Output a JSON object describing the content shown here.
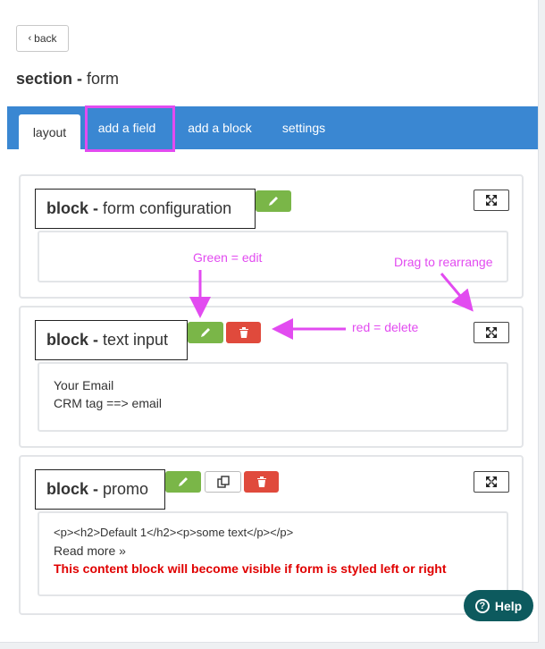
{
  "header": {
    "back_label": "back",
    "title_bold": "section -",
    "title_rest": "form"
  },
  "tabs": [
    {
      "label": "layout",
      "active": true
    },
    {
      "label": "add a field",
      "active": false
    },
    {
      "label": "add a block",
      "active": false
    },
    {
      "label": "settings",
      "active": false
    }
  ],
  "blocks": [
    {
      "kind_label": "block -",
      "name": "form configuration",
      "lines": []
    },
    {
      "kind_label": "block -",
      "name": "text input",
      "lines": [
        "Your Email",
        "CRM tag ==> email"
      ]
    },
    {
      "kind_label": "block -",
      "name": "promo",
      "lines": [
        "<p><h2>Default 1</h2><p>some text</p></p>",
        "Read more »"
      ],
      "warning": "This content block will become visible if form is styled left or right"
    }
  ],
  "annotations": {
    "edit": "Green = edit",
    "drag": "Drag to rearrange",
    "delete": "red = delete"
  },
  "help": {
    "label": "Help"
  },
  "colors": {
    "tabbar": "#3a87d2",
    "edit_green": "#7ab648",
    "delete_red": "#e04a3c",
    "annotation_magenta": "#e24bf0",
    "help_bg": "#0d5a5e",
    "warning_red": "#e00000"
  }
}
